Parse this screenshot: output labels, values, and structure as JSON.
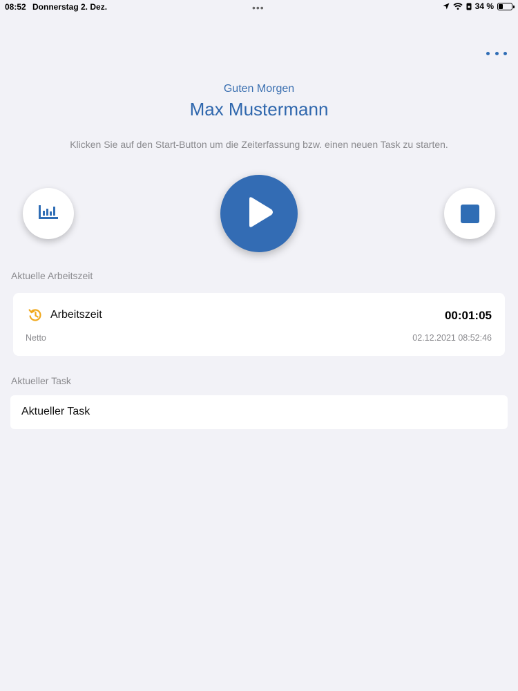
{
  "status_bar": {
    "time": "08:52",
    "date": "Donnerstag 2. Dez.",
    "multitask_indicator": "•••",
    "battery_percent": "34 %",
    "icons": [
      "location-arrow-icon",
      "wifi-icon",
      "lock-rotation-icon",
      "battery-icon"
    ]
  },
  "header": {
    "more_menu_icon": "more-horizontal-icon"
  },
  "greeting": {
    "salutation": "Guten Morgen",
    "user_name": "Max Mustermann"
  },
  "instruction": "Klicken Sie auf den Start-Button um die Zeiterfassung bzw. einen neuen Task zu starten.",
  "controls": {
    "statistics_icon": "bar-chart-icon",
    "start_icon": "play-icon",
    "stop_icon": "stop-icon"
  },
  "current_work": {
    "section_title": "Aktuelle Arbeitszeit",
    "icon": "history-icon",
    "label": "Arbeitszeit",
    "duration": "00:01:05",
    "sublabel": "Netto",
    "timestamp": "02.12.2021 08:52:46"
  },
  "current_task": {
    "section_title": "Aktueller Task",
    "label": "Aktueller Task"
  },
  "colors": {
    "background": "#f2f2f7",
    "accent": "#336cb4",
    "history_icon": "#f0a81c",
    "secondary_text": "#8a8a8e"
  }
}
